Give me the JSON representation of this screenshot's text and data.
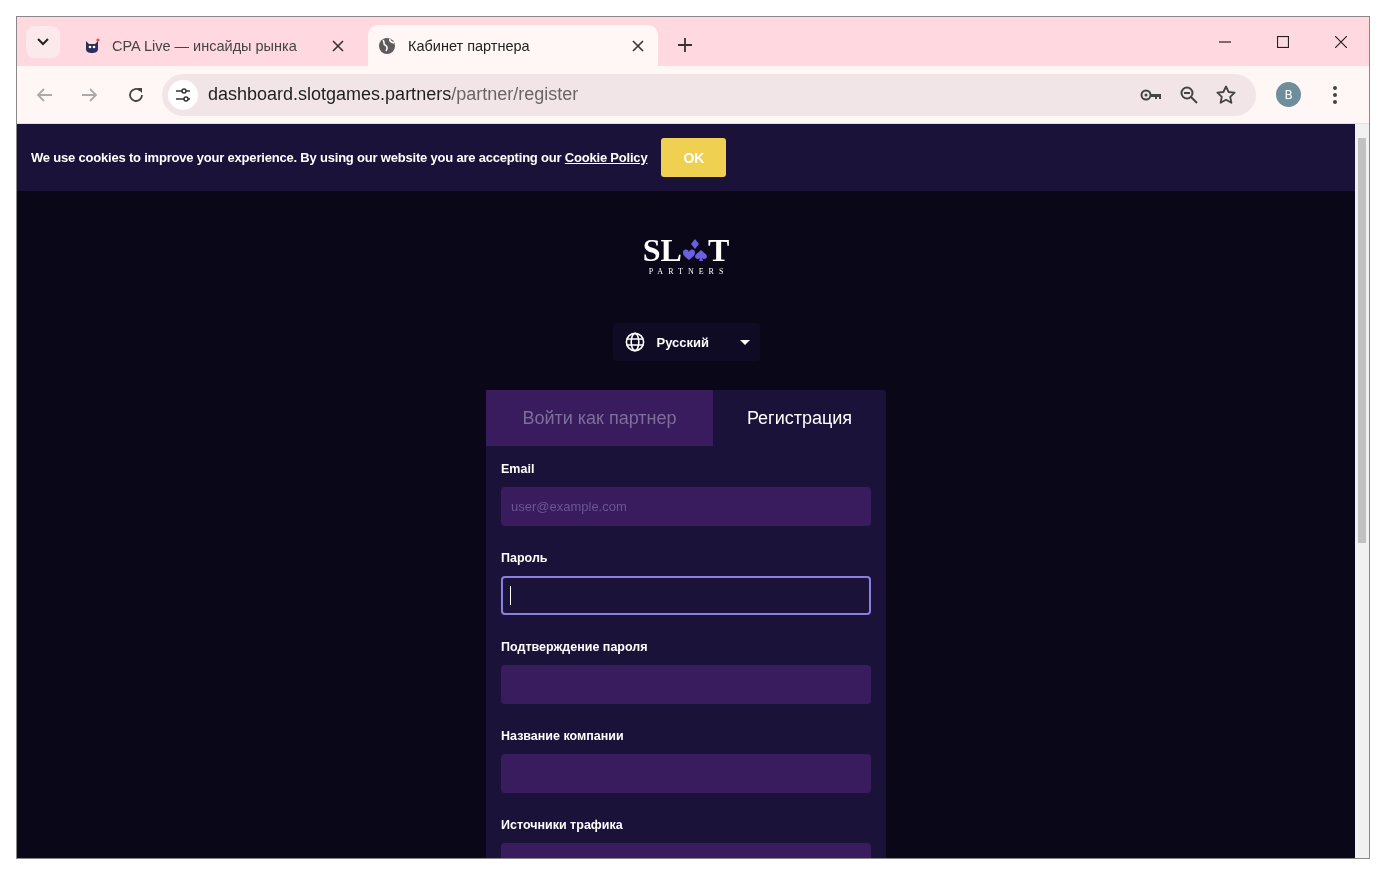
{
  "browser": {
    "tabs": [
      {
        "title": "CPA Live — инсайды рынка",
        "selected": false
      },
      {
        "title": "Кабинет партнера",
        "selected": true
      }
    ],
    "address": {
      "host": "dashboard.slotgames.partners",
      "path": "/partner/register"
    },
    "profile_initial": "B"
  },
  "cookie_banner": {
    "text": "We use cookies to improve your experience. By using our website you are accepting our ",
    "link": "Cookie Policy",
    "button": "OK"
  },
  "logo": {
    "left": "SL",
    "right": "T",
    "tagline": "PARTNERS"
  },
  "language": {
    "value": "Русский"
  },
  "auth_tabs": [
    {
      "label": "Войти как партнер",
      "selected": false
    },
    {
      "label": "Регистрация",
      "selected": true
    }
  ],
  "fields": [
    {
      "label": "Email",
      "placeholder": "user@example.com",
      "focused": false
    },
    {
      "label": "Пароль",
      "focused": true
    },
    {
      "label": "Подтверждение пароля",
      "focused": false
    },
    {
      "label": "Название компании",
      "focused": false
    },
    {
      "label": "Источники трафика",
      "focused": false
    }
  ]
}
